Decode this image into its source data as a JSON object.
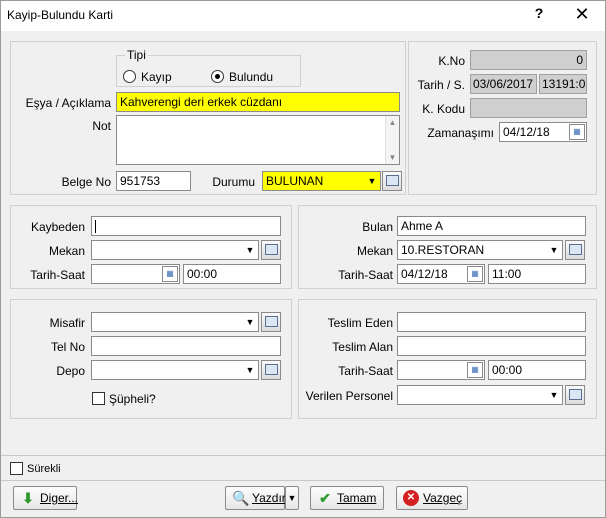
{
  "window": {
    "title": "Kayip-Bulundu Karti",
    "help": "?",
    "close": "✕"
  },
  "top": {
    "tipi_legend": "Tipi",
    "radio_kayip": "Kayıp",
    "radio_bulundu": "Bulundu",
    "esya_label": "Eşya / Açıklama",
    "esya_value": "Kahverengi deri erkek cüzdanı",
    "not_label": "Not",
    "belge_label": "Belge No",
    "belge_value": "951753",
    "durumu_label": "Durumu",
    "durumu_value": "BULUNAN"
  },
  "right": {
    "kno_label": "K.No",
    "kno_value": "0",
    "tarih_label": "Tarih / S.",
    "tarih_value": "03/06/2017",
    "saat_value": "13191:0",
    "kkodu_label": "K. Kodu",
    "kkodu_value": "",
    "zaman_label": "Zamanaşımı",
    "zaman_value": "04/12/18"
  },
  "kaybeden": {
    "kaybeden_label": "Kaybeden",
    "kaybeden_value": "",
    "mekan_label": "Mekan",
    "mekan_value": "",
    "tarih_label": "Tarih-Saat",
    "tarih_value": "",
    "saat_value": "00:00"
  },
  "bulan": {
    "bulan_label": "Bulan",
    "bulan_value": "Ahme A",
    "mekan_label": "Mekan",
    "mekan_value": "10.RESTORAN",
    "tarih_label": "Tarih-Saat",
    "tarih_value": "04/12/18",
    "saat_value": "11:00"
  },
  "misafir": {
    "misafir_label": "Misafir",
    "telno_label": "Tel No",
    "depo_label": "Depo",
    "supheli_label": "Şüpheli?"
  },
  "teslim": {
    "eden_label": "Teslim Eden",
    "alan_label": "Teslim Alan",
    "tarih_label": "Tarih-Saat",
    "saat_value": "00:00",
    "personel_label": "Verilen Personel"
  },
  "footer": {
    "surekli_label": "Sürekli",
    "diger_label": "Diger...",
    "yazdir_label": "Yazdır",
    "tamam_label": "Tamam",
    "vazgec_label": "Vazgeç"
  }
}
